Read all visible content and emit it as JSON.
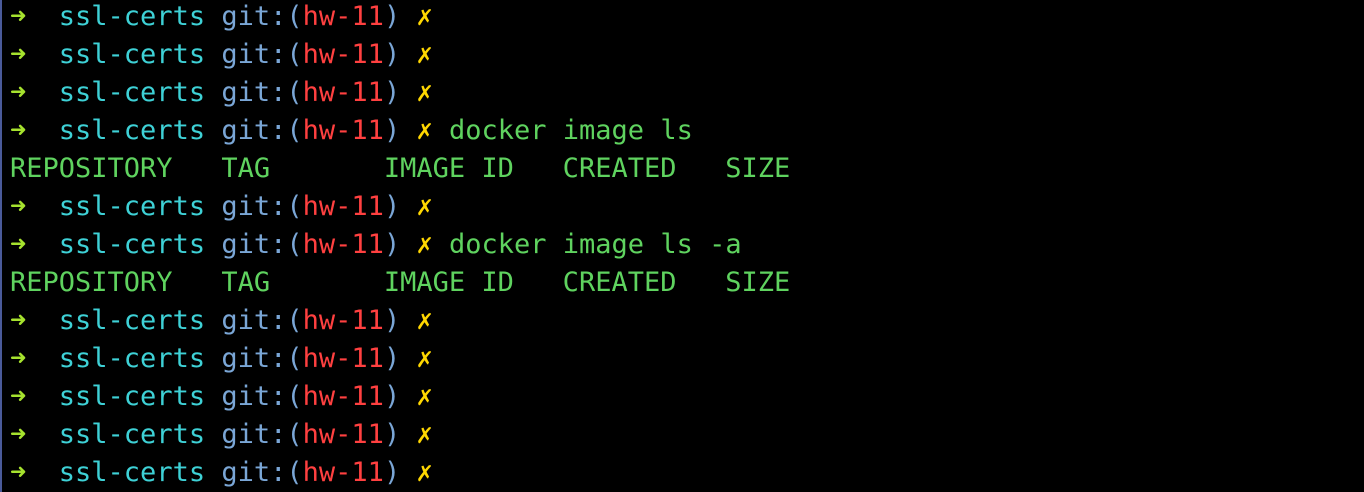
{
  "prompt": {
    "arrow": "➜",
    "dir": "ssl-certs",
    "git_label": "git:",
    "paren_open": "(",
    "branch": "hw-11",
    "paren_close": ")",
    "dirty_mark": "✗"
  },
  "lines": [
    {
      "type": "prompt",
      "command": ""
    },
    {
      "type": "prompt",
      "command": ""
    },
    {
      "type": "prompt",
      "command": ""
    },
    {
      "type": "prompt",
      "command": "docker image ls"
    },
    {
      "type": "output",
      "text": "REPOSITORY   TAG       IMAGE ID   CREATED   SIZE"
    },
    {
      "type": "prompt",
      "command": ""
    },
    {
      "type": "prompt",
      "command": "docker image ls -a"
    },
    {
      "type": "output",
      "text": "REPOSITORY   TAG       IMAGE ID   CREATED   SIZE"
    },
    {
      "type": "prompt",
      "command": ""
    },
    {
      "type": "prompt",
      "command": ""
    },
    {
      "type": "prompt",
      "command": ""
    },
    {
      "type": "prompt",
      "command": ""
    },
    {
      "type": "prompt",
      "command": ""
    }
  ],
  "colors": {
    "background": "#000000",
    "arrow": "#a6e22e",
    "dir": "#3ed1d6",
    "git": "#7aa6d6",
    "branch": "#ff4040",
    "dirty": "#ffd700",
    "command": "#5fd35f"
  }
}
